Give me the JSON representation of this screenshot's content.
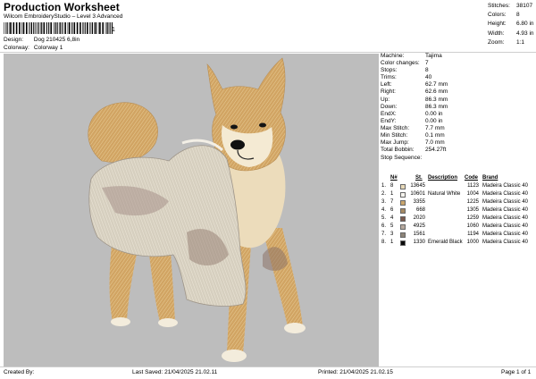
{
  "header": {
    "title": "Production Worksheet",
    "subtitle": "Wilcom EmbroideryStudio – Level 3 Advanced",
    "barcode_suffix": "1",
    "design_label": "Design:",
    "design_value": "Dog 210425 6,8in",
    "colorway_label": "Colorway:",
    "colorway_value": "Colorway 1"
  },
  "stats": [
    {
      "label": "Stitches:",
      "value": "38107"
    },
    {
      "label": "Colors:",
      "value": "8"
    },
    {
      "label": "Height:",
      "value": "6.80 in"
    },
    {
      "label": "Width:",
      "value": "4.93 in"
    },
    {
      "label": "Zoom:",
      "value": "1:1"
    }
  ],
  "info": [
    {
      "label": "Machine:",
      "value": "Tajima"
    },
    {
      "label": "Color changes:",
      "value": "7"
    },
    {
      "label": "Stops:",
      "value": "8"
    },
    {
      "label": "Trims:",
      "value": "40"
    },
    {
      "label": "Left:",
      "value": "62.7 mm"
    },
    {
      "label": "Right:",
      "value": "62.6 mm"
    },
    {
      "label": "Up:",
      "value": "86.3 mm"
    },
    {
      "label": "Down:",
      "value": "86.3 mm"
    },
    {
      "label": "EndX:",
      "value": "0.00 in"
    },
    {
      "label": "EndY:",
      "value": "0.00 in"
    },
    {
      "label": "Max Stitch:",
      "value": "7.7 mm"
    },
    {
      "label": "Min Stitch:",
      "value": "0.1 mm"
    },
    {
      "label": "Max Jump:",
      "value": "7.0 mm"
    },
    {
      "label": "Total Bobbin:",
      "value": "254.27ft"
    }
  ],
  "stop_sequence": {
    "title": "Stop Sequence:",
    "headers": {
      "n": "N#",
      "st": "St.",
      "desc": "Description",
      "code": "Code",
      "brand": "Brand"
    },
    "rows": [
      {
        "order": "1.",
        "n": "8",
        "color": "#e8d9b8",
        "st": "13645",
        "desc": "",
        "code": "1123",
        "brand": "Madeira Classic 40"
      },
      {
        "order": "2.",
        "n": "1",
        "color": "#f6f4ee",
        "st": "10601",
        "desc": "Natural White",
        "code": "1004",
        "brand": "Madeira Classic 40"
      },
      {
        "order": "3.",
        "n": "7",
        "color": "#c9a56d",
        "st": "3355",
        "desc": "",
        "code": "1225",
        "brand": "Madeira Classic 40"
      },
      {
        "order": "4.",
        "n": "6",
        "color": "#a58a63",
        "st": "668",
        "desc": "",
        "code": "1305",
        "brand": "Madeira Classic 40"
      },
      {
        "order": "5.",
        "n": "4",
        "color": "#7b5a4e",
        "st": "2020",
        "desc": "",
        "code": "1259",
        "brand": "Madeira Classic 40"
      },
      {
        "order": "6.",
        "n": "5",
        "color": "#b7a99e",
        "st": "4925",
        "desc": "",
        "code": "1060",
        "brand": "Madeira Classic 40"
      },
      {
        "order": "7.",
        "n": "3",
        "color": "#8d8478",
        "st": "1561",
        "desc": "",
        "code": "1194",
        "brand": "Madeira Classic 40"
      },
      {
        "order": "8.",
        "n": "1",
        "color": "#0b0b0b",
        "st": "1330",
        "desc": "Emerald Black",
        "code": "1000",
        "brand": "Madeira Classic 40"
      }
    ]
  },
  "footer": {
    "created_by": "Created By:",
    "last_saved": "Last Saved: 21/04/2025 21.02.11",
    "printed": "Printed: 21/04/2025 21.02.15",
    "page": "Page 1 of 1"
  },
  "colors": {
    "canvas_bg": "#bdbdbd",
    "fur": "#d4a766",
    "fur_light": "#efdcb4",
    "coat": "#d9d2c3",
    "coat_dark": "#8c7267"
  }
}
